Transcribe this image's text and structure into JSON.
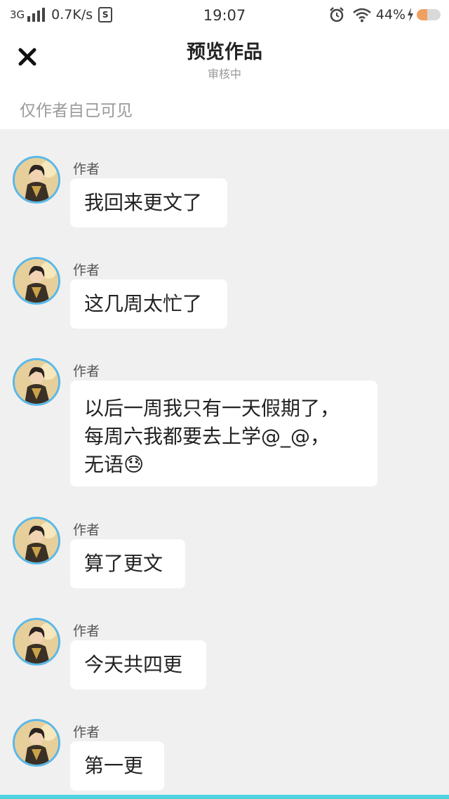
{
  "status_bar": {
    "network": "3G",
    "speed": "0.7K/s",
    "sim_icon": "S",
    "time": "19:07",
    "battery_percent_text": "44%",
    "battery_level": 0.44,
    "icons": [
      "signal-icon",
      "sim-icon",
      "alarm-icon",
      "wifi-icon",
      "charging-icon",
      "battery-icon"
    ]
  },
  "header": {
    "close_icon": "close-icon",
    "title": "预览作品",
    "subtitle": "审核中"
  },
  "visibility_note": "仅作者自己可见",
  "messages": [
    {
      "author": "作者",
      "text": "我回来更文了"
    },
    {
      "author": "作者",
      "text": "这几周太忙了"
    },
    {
      "author": "作者",
      "text": "以后一周我只有一天假期了，\n每周六我都要去上学@_@，\n无语😓"
    },
    {
      "author": "作者",
      "text": "算了更文"
    },
    {
      "author": "作者",
      "text": "今天共四更"
    },
    {
      "author": "作者",
      "text": "第一更"
    }
  ],
  "colors": {
    "accent_border": "#5ab8e8",
    "bottom_bar": "#4fd3e0",
    "battery": "#f0a060",
    "page_bg": "#f0f0f0"
  }
}
